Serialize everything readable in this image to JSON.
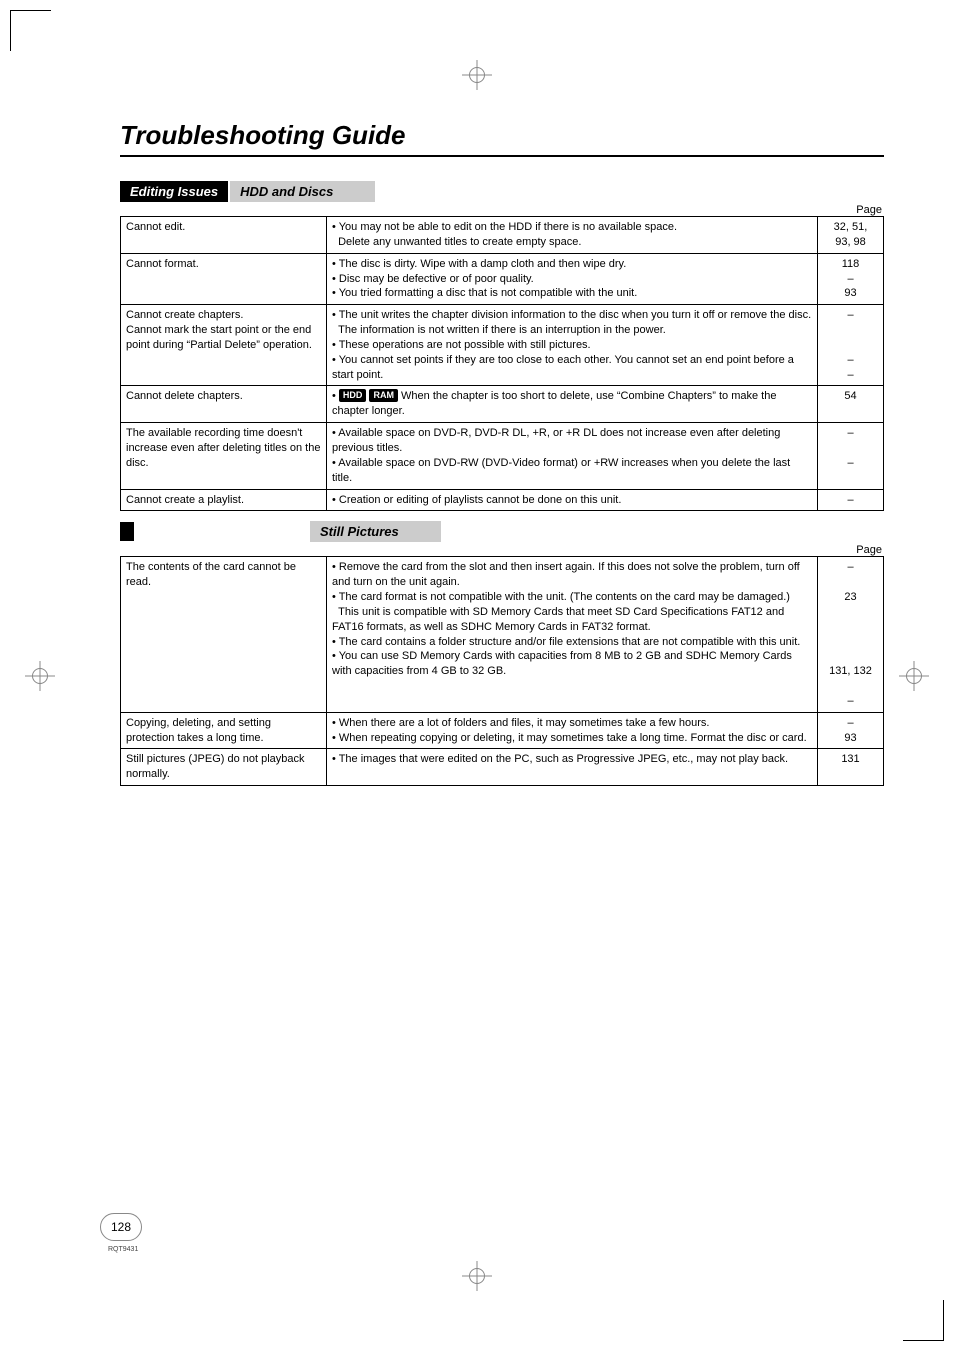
{
  "title": "Troubleshooting Guide",
  "pageLabel": "Page",
  "sections": {
    "editing": {
      "blackLabel": "Editing Issues",
      "greyLabel": "HDD and Discs",
      "rows": [
        {
          "issue": "Cannot edit.",
          "desc_html": "• You may not be able to edit on the HDD if there is no available space.<br>&nbsp;&nbsp;Delete any unwanted titles to create empty space.",
          "pages_html": "32, 51,<br>93, 98"
        },
        {
          "issue": "Cannot format.",
          "desc_html": "• The disc is dirty. Wipe with a damp cloth and then wipe dry.<br>• Disc may be defective or of poor quality.<br>• You tried formatting a disc that is not compatible with the unit.",
          "pages_html": "118<br>–<br>93"
        },
        {
          "issue": "Cannot create chapters.<br>Cannot mark the start point or the end point during “Partial Delete” operation.",
          "desc_html": "• The unit writes the chapter division information to the disc when you turn it off or remove the disc.<br>&nbsp;&nbsp;The information is not written if there is an interruption in the power.<br>• These operations are not possible with still pictures.<br>• You cannot set points if they are too close to each other. You cannot set an end point before a start point.",
          "pages_html": "–<br><br><br>–<br>–"
        },
        {
          "issue": "Cannot delete chapters.",
          "desc_html": "• <span class=\"badge\">HDD</span> <span class=\"badge\">RAM</span> When the chapter is too short to delete, use “Combine Chapters” to make the chapter longer.",
          "pages_html": "54"
        },
        {
          "issue": "The available recording time doesn't increase even after deleting titles on the disc.",
          "desc_html": "• Available space on DVD-R, DVD-R DL, +R, or +R DL does not increase even after deleting previous titles.<br>• Available space on DVD-RW (DVD-Video format) or +RW increases when you delete the last title.",
          "pages_html": "–<br><br>–"
        },
        {
          "issue": "Cannot create a playlist.",
          "desc_html": "• Creation or editing of playlists cannot be done on this unit.",
          "pages_html": "–"
        }
      ]
    },
    "still": {
      "greyLabel": "Still Pictures",
      "rows": [
        {
          "issue": "The contents of the card cannot be read.",
          "desc_html": "• Remove the card from the slot and then insert again. If this does not solve the problem, turn off and turn on the unit again.<br>• The card format is not compatible with the unit. (The contents on the card may be damaged.)<br>&nbsp;&nbsp;This unit is compatible with SD Memory Cards that meet SD Card Specifications FAT12 and FAT16 formats, as well as SDHC Memory Cards in FAT32 format.<br>• The card contains a folder structure and/or file extensions that are not compatible with this unit.<br>• You can use SD Memory Cards with capacities from 8 MB to 2 GB and SDHC Memory Cards with capacities from 4 GB to 32 GB.",
          "pages_html": "–<br><br>23<br><br><br><br><br>131, 132<br><br>–"
        },
        {
          "issue": "Copying, deleting, and setting protection takes a long time.",
          "desc_html": "• When there are a lot of folders and files, it may sometimes take a few hours.<br>• When repeating copying or deleting, it may sometimes take a long time. Format the disc or card.",
          "pages_html": "–<br>93"
        },
        {
          "issue": "Still pictures (JPEG) do not playback normally.",
          "desc_html": "• The images that were edited on the PC, such as Progressive JPEG, etc., may not play back.",
          "pages_html": "131"
        }
      ]
    }
  },
  "pageNumber": "128",
  "footerCode": "RQT9431"
}
